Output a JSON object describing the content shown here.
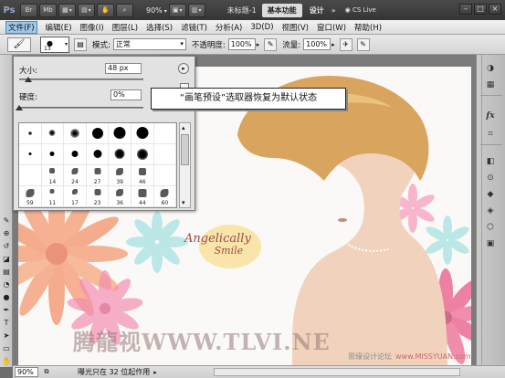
{
  "app": {
    "logo": "Ps",
    "bar_buttons": [
      "Br",
      "Mb"
    ],
    "zoom_level": "90%",
    "doc_title": "未标题-1",
    "workspace_active": "基本功能",
    "workspace_design": "设计",
    "workspace_more": "»",
    "cs_live": "CS Live",
    "win_minimize": "–",
    "win_restore": "□",
    "win_close": "×"
  },
  "menu": [
    "文件(F)",
    "编辑(E)",
    "图像(I)",
    "图层(L)",
    "选择(S)",
    "滤镜(T)",
    "分析(A)",
    "3D(D)",
    "视图(V)",
    "窗口(W)",
    "帮助(H)"
  ],
  "options": {
    "brush_size_num": "13",
    "mode_label": "模式:",
    "mode_value": "正常",
    "opacity_label": "不透明度:",
    "opacity_value": "100%",
    "flow_label": "流量:",
    "flow_value": "100%"
  },
  "brush_panel": {
    "size_label": "大小:",
    "size_value": "48 px",
    "hardness_label": "硬度:",
    "hardness_value": "0%",
    "size_fraction": 0.07,
    "hardness_fraction": 0.0,
    "menu_glyph": "▸",
    "grid_rows": [
      [
        "",
        "",
        "",
        "",
        "",
        "",
        ""
      ],
      [
        "",
        "",
        "",
        "",
        "",
        "",
        ""
      ],
      [
        "",
        "14",
        "24",
        "27",
        "39",
        "46",
        ""
      ],
      [
        "59",
        "11",
        "17",
        "23",
        "36",
        "44",
        "60"
      ]
    ]
  },
  "callout": {
    "text": "“画笔预设”选取器恢复为默认状态"
  },
  "canvas": {
    "brand_line1": "Angelically",
    "brand_line2": "Smile",
    "watermark": "腾龍视WWW.TLVI.NE",
    "corner_text1": "思缘设计论坛",
    "corner_text2": "www.MISSYUAN.com"
  },
  "status": {
    "zoom": "90%",
    "text": "曝光只在 32 位起作用"
  },
  "colors": {
    "app_bar": "#3e3e3e",
    "menu_bar": "#e6e6e6",
    "panel": "#e2e2e2",
    "accent": "#9ec7ec"
  },
  "icons": {
    "toolbar": [
      "move-icon",
      "marquee-icon",
      "lasso-icon",
      "magic-wand-icon",
      "crop-icon",
      "eyedropper-icon",
      "spot-heal-icon",
      "brush-icon",
      "clone-stamp-icon",
      "history-brush-icon",
      "eraser-icon",
      "gradient-icon",
      "blur-icon",
      "dodge-icon",
      "pen-icon",
      "type-icon",
      "path-select-icon",
      "shape-icon",
      "hand-icon",
      "zoom-icon"
    ],
    "right_panel": [
      "color-icon",
      "swatches-icon",
      "adjustments-icon",
      "masks-icon",
      "layers-icon",
      "channels-icon",
      "paths-icon",
      "3d-icon"
    ]
  }
}
